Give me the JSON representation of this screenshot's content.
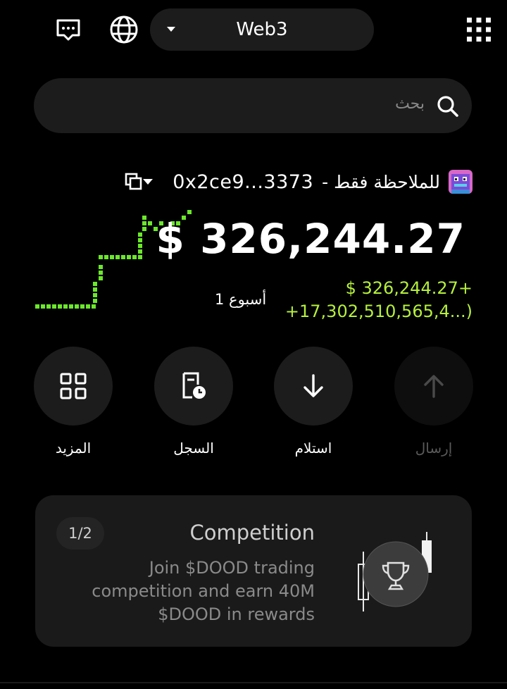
{
  "header": {
    "network_label": "Web3",
    "icons": [
      "chat-icon",
      "globe-icon",
      "chevron-down-icon",
      "grid-icon"
    ]
  },
  "search": {
    "placeholder": "بحث"
  },
  "wallet": {
    "label": "للملاحظة فقط -",
    "address": "0x2ce9...3373"
  },
  "balance": {
    "value": "$ 326,244.27",
    "change_amount": "+326,244.27 $",
    "change_percent": "+17,302,510,565,4...)",
    "period": "أسبوع 1"
  },
  "actions": [
    {
      "label": "المزيد",
      "icon": "grid-icon",
      "enabled": true
    },
    {
      "label": "السجل",
      "icon": "history-icon",
      "enabled": true
    },
    {
      "label": "استلام",
      "icon": "arrow-down-icon",
      "enabled": true
    },
    {
      "label": "إرسال",
      "icon": "arrow-up-icon",
      "enabled": false
    }
  ],
  "promo": {
    "pager": "1/2",
    "title": "Competition",
    "description": "Join $DOOD trading competition and earn 40M $DOOD in rewards"
  },
  "colors": {
    "accent_green": "#b5f03c",
    "chart_green": "#6be82a",
    "surface": "#1c1c1c",
    "background": "#000000"
  }
}
